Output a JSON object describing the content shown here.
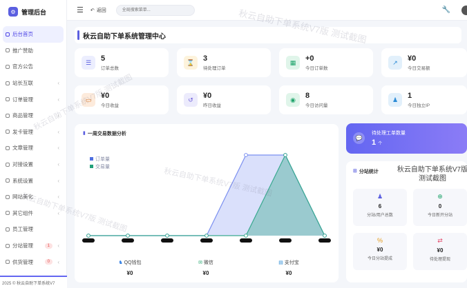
{
  "brand": {
    "name": "管理后台",
    "icon": "gear-icon"
  },
  "sidebar": {
    "items": [
      {
        "label": "后台首页",
        "active": true
      },
      {
        "label": "推广赞助"
      },
      {
        "label": "官方公告"
      },
      {
        "label": "站长互联",
        "chevron": "‹"
      },
      {
        "label": "订单管理",
        "chevron": "‹"
      },
      {
        "label": "商品管理",
        "chevron": "‹"
      },
      {
        "label": "发卡管理",
        "chevron": "‹"
      },
      {
        "label": "文章管理",
        "chevron": "‹"
      },
      {
        "label": "对接设置",
        "chevron": "‹"
      },
      {
        "label": "系统设置",
        "chevron": "‹"
      },
      {
        "label": "网站美化",
        "chevron": "‹"
      },
      {
        "label": "其它组件",
        "chevron": "‹"
      },
      {
        "label": "员工管理"
      },
      {
        "label": "分站管理",
        "chevron": "‹",
        "badge": "1"
      },
      {
        "label": "供货管理",
        "chevron": "‹",
        "badge": "0"
      }
    ],
    "footer": "2025 © 秋云自助下单系统V7"
  },
  "topbar": {
    "back_label": "返回",
    "search_placeholder": "全局搜索菜单..."
  },
  "page_title": "秋云自助下单系统管理中心",
  "stats": [
    {
      "value": "5",
      "label": "订单总数",
      "icon": "list-icon",
      "color": "#5b5fe0",
      "bg": "#eceefe"
    },
    {
      "value": "3",
      "label": "待处理订单",
      "icon": "hourglass-icon",
      "color": "#d49a1a",
      "bg": "#fdf3dc"
    },
    {
      "value": "+0",
      "label": "今日订单数",
      "icon": "calendar-icon",
      "color": "#1fa46b",
      "bg": "#e0f5ea"
    },
    {
      "value": "¥0",
      "label": "今日交易额",
      "icon": "chart-up-icon",
      "color": "#2a8bd6",
      "bg": "#e2f0fb"
    },
    {
      "value": "¥0",
      "label": "今日收益",
      "icon": "money-icon",
      "color": "#e47d2a",
      "bg": "#fdebdc"
    },
    {
      "value": "¥0",
      "label": "昨日收益",
      "icon": "history-icon",
      "color": "#6a5ad8",
      "bg": "#ecebfc"
    },
    {
      "value": "8",
      "label": "今日访问量",
      "icon": "eye-icon",
      "color": "#1fa46b",
      "bg": "#e0f5ea"
    },
    {
      "value": "1",
      "label": "今日独立IP",
      "icon": "users-icon",
      "color": "#2a8bd6",
      "bg": "#e2f0fb"
    }
  ],
  "chart": {
    "title": "一周交易数据分析",
    "legend": [
      "订单量",
      "交易量"
    ],
    "colors": [
      "#7b8ff0",
      "#39a98f"
    ]
  },
  "chart_data": {
    "type": "area",
    "title": "一周交易数据分析",
    "categories": [
      "",
      "",
      "",
      "",
      "",
      "",
      ""
    ],
    "series": [
      {
        "name": "订单量",
        "values": [
          0,
          0,
          0,
          0,
          5,
          5,
          0
        ]
      },
      {
        "name": "交易量",
        "values": [
          0,
          0,
          0,
          0,
          0,
          5,
          0
        ]
      }
    ],
    "ylim": [
      0,
      5
    ],
    "legend_position": "top-left",
    "grid": false
  },
  "payments": [
    {
      "label": "QQ钱包",
      "value": "¥0",
      "icon": "qq-icon"
    },
    {
      "label": "微信",
      "value": "¥0",
      "icon": "wechat-icon"
    },
    {
      "label": "支付宝",
      "value": "¥0",
      "icon": "alipay-icon"
    }
  ],
  "work_order": {
    "title": "待处理工单数量",
    "value": "1",
    "unit": "个"
  },
  "substation": {
    "title": "分站统计",
    "items": [
      {
        "value": "6",
        "label": "分站/用户总数",
        "icon": "users-icon",
        "color": "#5b5fe0"
      },
      {
        "value": "0",
        "label": "今日新开分站",
        "icon": "plus-circle-icon",
        "color": "#1fa46b"
      },
      {
        "value": "¥0",
        "label": "今日分站提成",
        "icon": "percent-icon",
        "color": "#e49a1a"
      },
      {
        "value": "¥0",
        "label": "待处理提现",
        "icon": "exchange-icon",
        "color": "#e34b6b"
      }
    ]
  },
  "watermark": {
    "text": "秋云自助下单系统V7版 测试截图",
    "title_lines": [
      "秋云自助下单系统V7版",
      "测试截图"
    ]
  }
}
